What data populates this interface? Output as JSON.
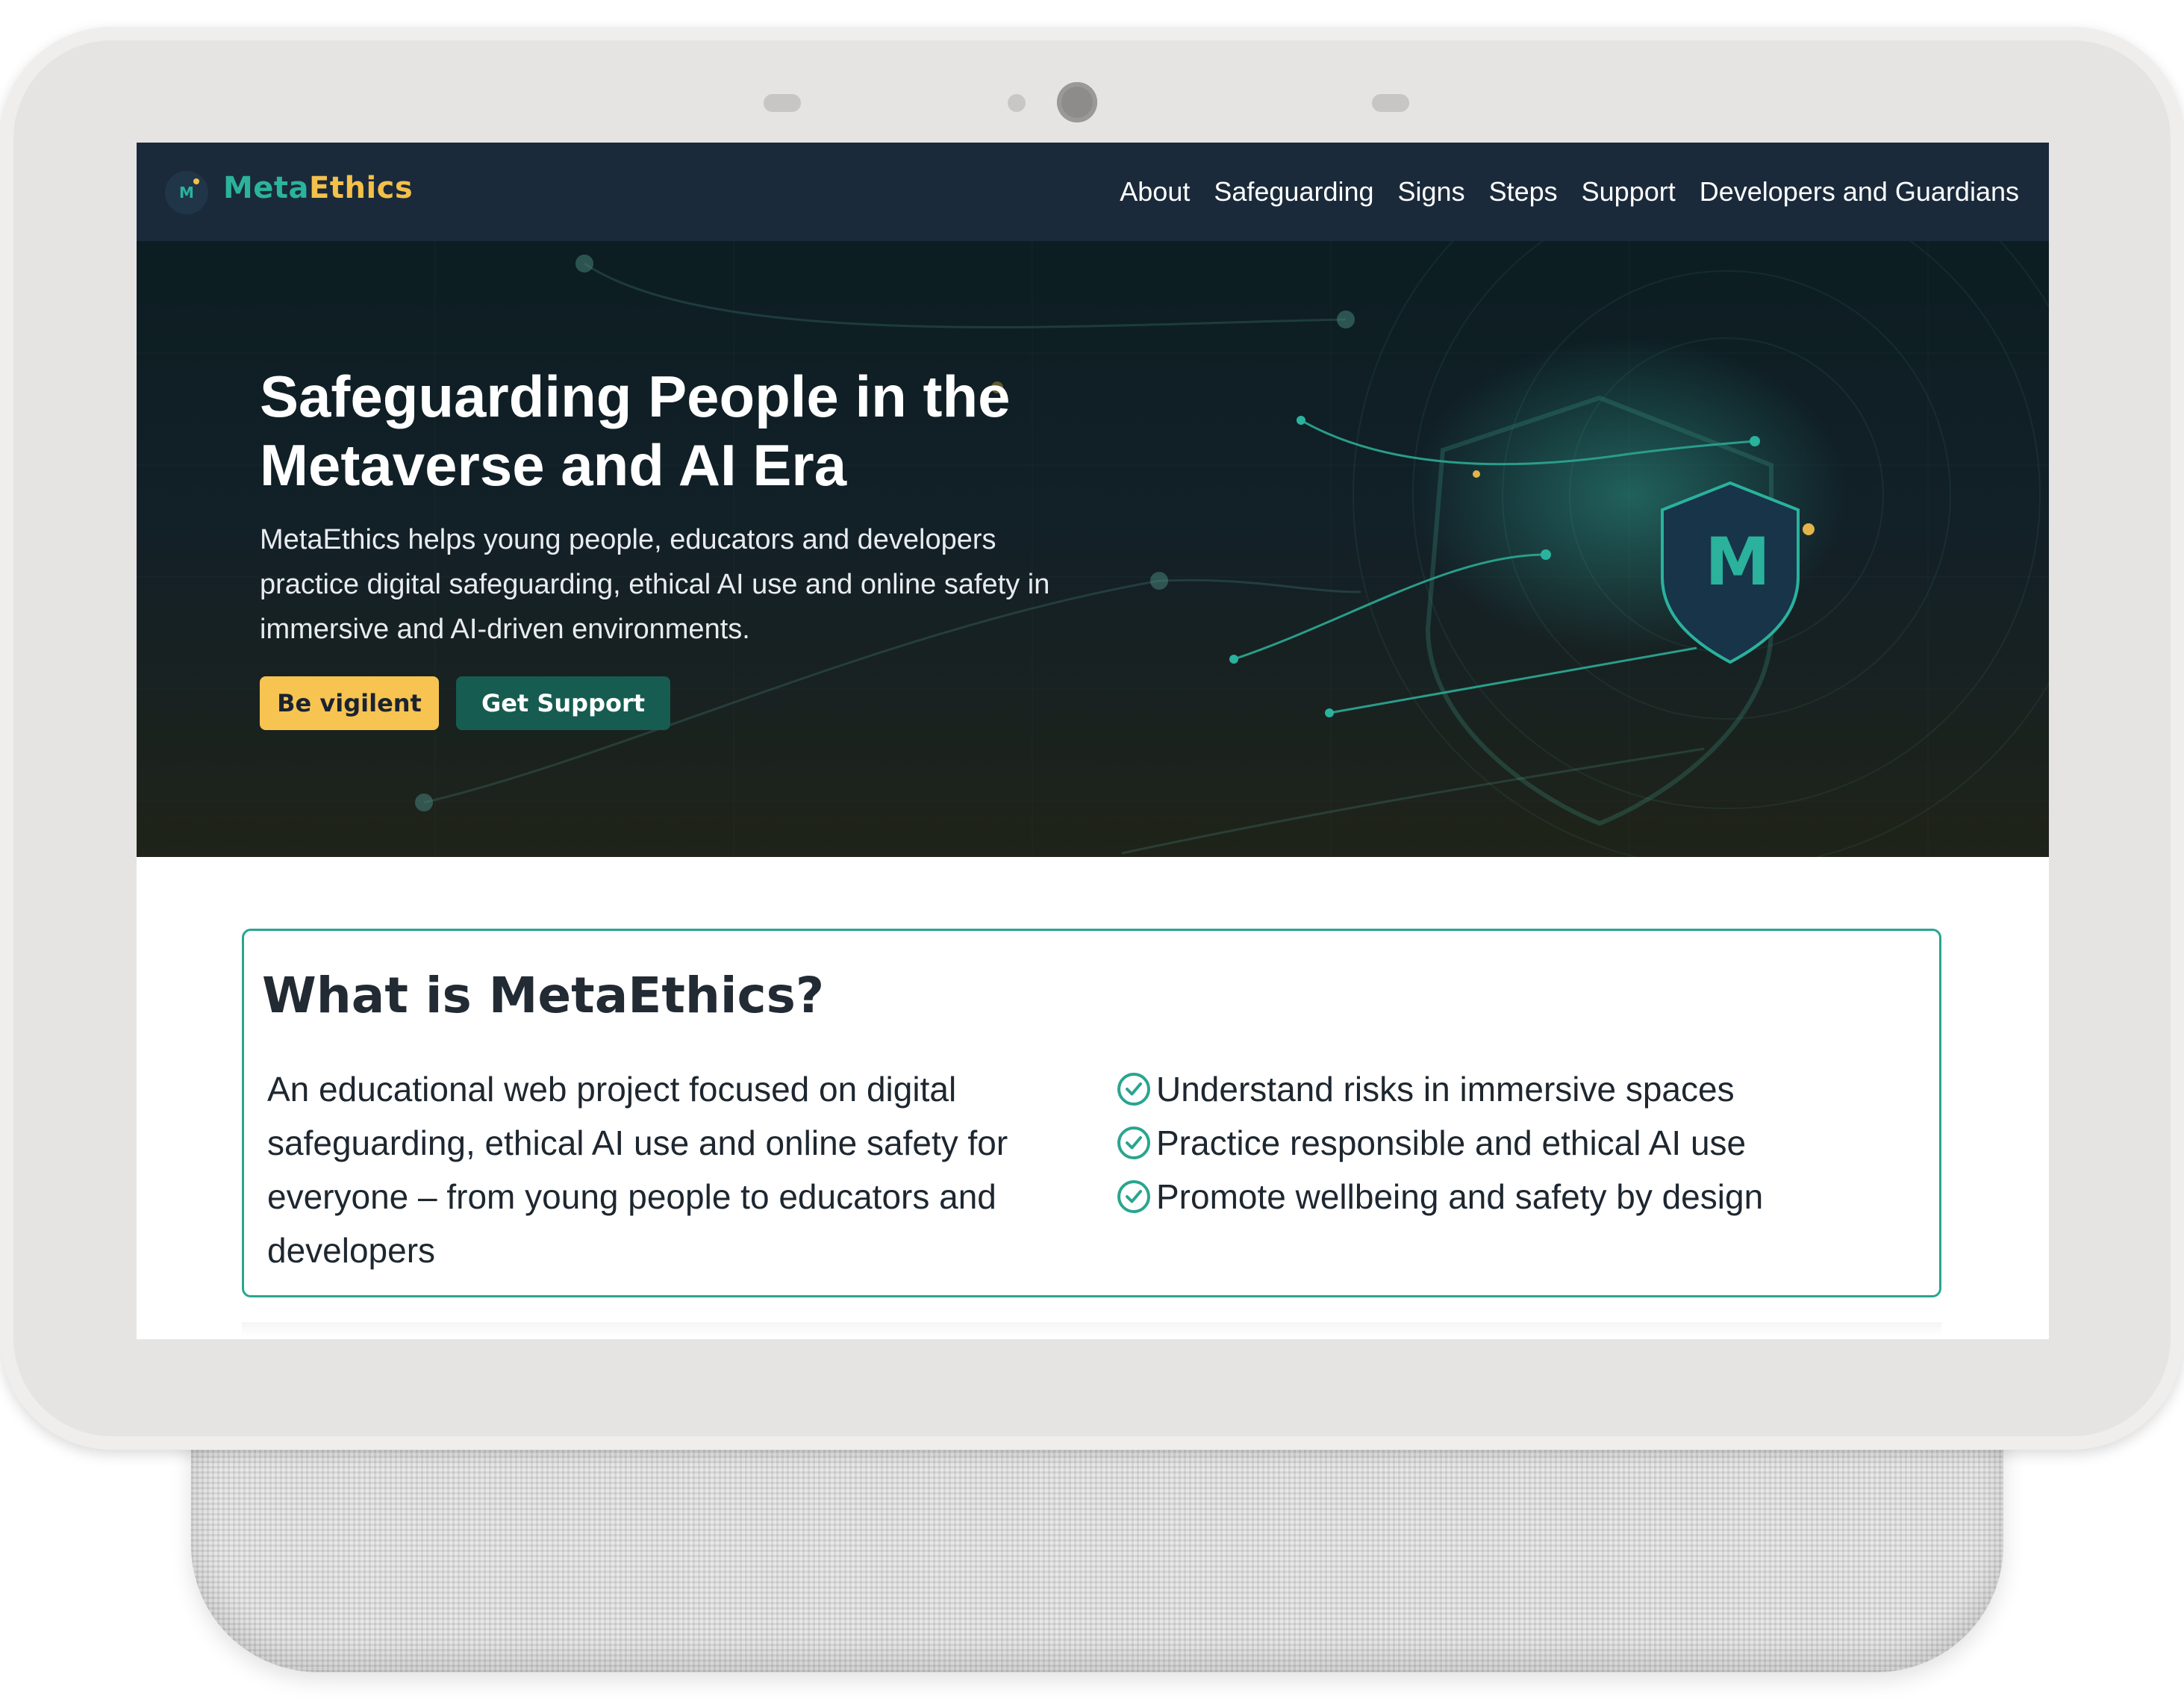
{
  "brand": {
    "name_part1": "Meta",
    "name_part2": "Ethics",
    "logo_letter": "M"
  },
  "nav": {
    "links": [
      "About",
      "Safeguarding",
      "Signs",
      "Steps",
      "Support",
      "Developers and Guardians"
    ]
  },
  "hero": {
    "title": "Safeguarding People in the Metaverse and AI Era",
    "subtitle": "MetaEthics helps young people, educators and developers practice digital safeguarding, ethical AI use and online safety in immersive and AI-driven environments.",
    "buttons": {
      "primary": "Be vigilent",
      "secondary": "Get Support"
    },
    "shield_letter": "M"
  },
  "about": {
    "title": "What is MetaEthics?",
    "description": "An educational web project focused on digital safeguarding, ethical AI use and online safety for everyone – from young people to educators and developers",
    "points": [
      "Understand risks in immersive spaces",
      "Practice responsible and ethical AI use",
      "Promote wellbeing and safety by design"
    ]
  },
  "colors": {
    "navbar": "#1a2a3b",
    "brand_teal": "#2bb39c",
    "brand_yellow": "#f4c04a",
    "button_yellow": "#f7c452",
    "button_teal": "#165c51",
    "card_border": "#2aa58f"
  },
  "icons": [
    "check-circle-icon",
    "shield-icon",
    "logo-icon"
  ]
}
